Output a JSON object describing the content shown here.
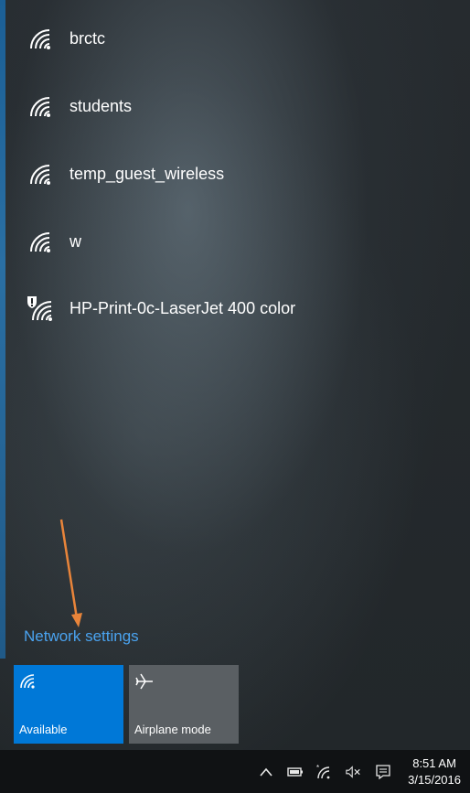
{
  "networks": [
    {
      "name": "brctc",
      "secured": false
    },
    {
      "name": "students",
      "secured": false
    },
    {
      "name": "temp_guest_wireless",
      "secured": false
    },
    {
      "name": "w",
      "secured": false
    },
    {
      "name": "HP-Print-0c-LaserJet 400 color",
      "secured": false,
      "shield": true
    }
  ],
  "network_settings_label": "Network settings",
  "quick_actions": {
    "wifi": {
      "label": "Available",
      "state": "on",
      "color": "#0078d7"
    },
    "airplane": {
      "label": "Airplane mode",
      "state": "off",
      "color": "#5a5f63"
    }
  },
  "taskbar": {
    "time": "8:51 AM",
    "date": "3/15/2016",
    "icons": [
      "chevron-up-icon",
      "battery-icon",
      "wifi-icon",
      "volume-muted-icon",
      "action-center-icon"
    ]
  },
  "annotation": {
    "arrow_color": "#e8843a"
  }
}
